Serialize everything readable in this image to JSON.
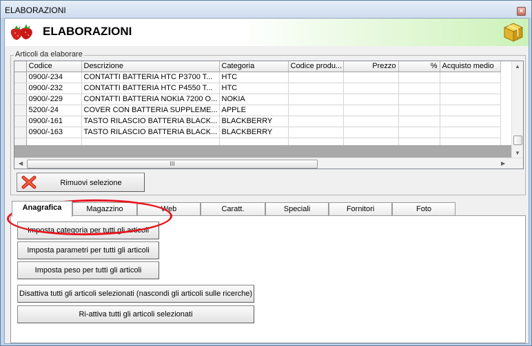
{
  "window": {
    "title": "ELABORAZIONI",
    "close_glyph": "×"
  },
  "header": {
    "title": "ELABORAZIONI",
    "left_icon": "strawberry-icon",
    "right_icon": "package-icon"
  },
  "articles_group": {
    "legend": "Articoli da elaborare",
    "columns": [
      "Codice",
      "Descrizione",
      "Categoria",
      "Codice produ...",
      "Prezzo",
      "%",
      "Acquisto medio"
    ],
    "rows": [
      [
        "0900/-234",
        "CONTATTI BATTERIA HTC P3700 T...",
        "HTC",
        "",
        "",
        "",
        ""
      ],
      [
        "0900/-232",
        "CONTATTI BATTERIA HTC P4550 T...",
        "HTC",
        "",
        "",
        "",
        ""
      ],
      [
        "0900/-229",
        "CONTATTI BATTERIA NOKIA 7200 O...",
        "NOKIA",
        "",
        "",
        "",
        ""
      ],
      [
        "5200/-24",
        "COVER CON BATTERIA SUPPLEME...",
        "APPLE",
        "",
        "",
        "",
        ""
      ],
      [
        "0900/-161",
        "TASTO RILASCIO BATTERIA BLACK...",
        "BLACKBERRY",
        "",
        "",
        "",
        ""
      ],
      [
        "0900/-163",
        "TASTO RILASCIO BATTERIA BLACK...",
        "BLACKBERRY",
        "",
        "",
        "",
        ""
      ],
      [
        "",
        "",
        "",
        "",
        "",
        "",
        ""
      ]
    ],
    "hscroll_grip": "III",
    "remove_button": "Rimuovi selezione"
  },
  "tabs": [
    "Anagrafica",
    "Magazzino",
    "Web",
    "Caratt.",
    "Speciali",
    "Fornitori",
    "Foto"
  ],
  "active_tab": "Anagrafica",
  "actions": {
    "set_category": "Imposta categoria per tutti gli articoli",
    "set_params": "Imposta parametri per tutti gli articoli",
    "set_weight": "Imposta peso per tutti gli articoli",
    "deactivate": "Disattiva tutti gli articoli selezionati (nascondi gli articoli sulle ricerche)",
    "reactivate": "Ri-attiva tutti gli articoli selezionati"
  },
  "colors": {
    "highlight": "#e8141e",
    "header_gradient_end": "#ccf2b8",
    "grid_band": "#a9a9a9"
  }
}
